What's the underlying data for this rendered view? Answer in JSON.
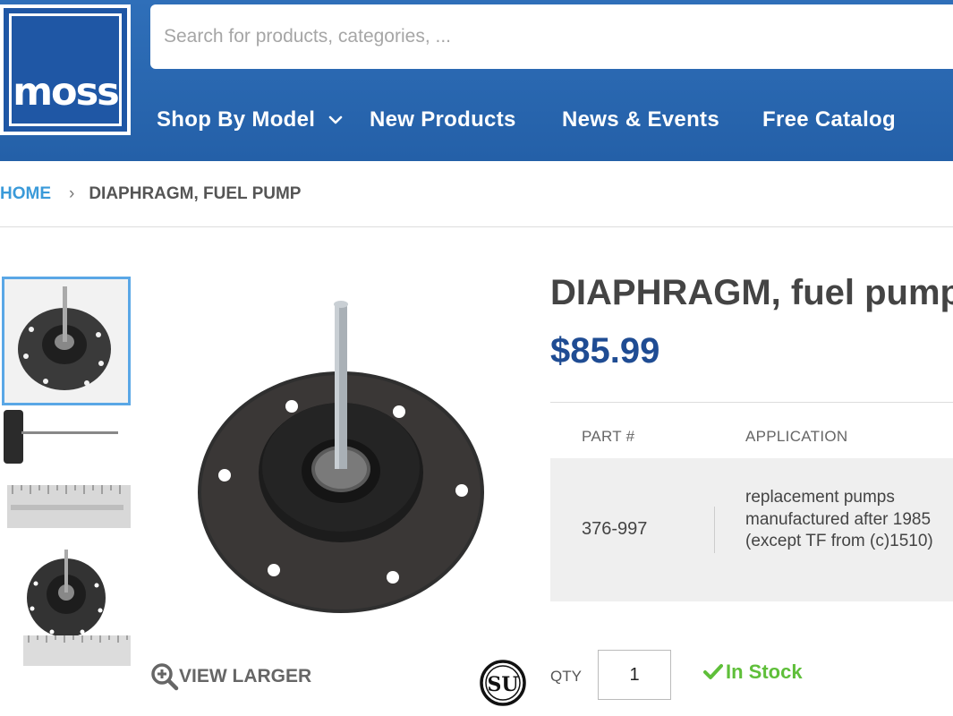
{
  "logo": {
    "text": "moss"
  },
  "search": {
    "placeholder": "Search for products, categories, ..."
  },
  "nav": {
    "items": [
      {
        "label": "Shop By Model"
      },
      {
        "label": "New Products"
      },
      {
        "label": "News & Events"
      },
      {
        "label": "Free Catalog"
      }
    ]
  },
  "breadcrumb": {
    "home": "HOME",
    "separator": "›",
    "current": "DIAPHRAGM, FUEL PUMP"
  },
  "product": {
    "title": "DIAPHRAGM, fuel pump",
    "price": "$85.99",
    "table": {
      "headers": [
        "PART #",
        "APPLICATION"
      ],
      "rows": [
        {
          "part": "376-997",
          "application": "replacement pumps manufactured after 1985 (except TF from (c)1510)"
        }
      ]
    },
    "qty_label": "QTY",
    "qty_value": "1",
    "stock": "In Stock",
    "view_larger": "VIEW LARGER",
    "brand_logo_text": "SU"
  },
  "colors": {
    "header_blue": "#2864ad",
    "price_blue": "#1f4c93",
    "link_blue": "#3a9ad9",
    "stock_green": "#5fbf3a",
    "thumb_active_border": "#5aa7e6"
  },
  "icons": {
    "dropdown": "chevron-down-icon",
    "zoom": "zoom-in-icon",
    "stock": "checkmark-icon"
  }
}
